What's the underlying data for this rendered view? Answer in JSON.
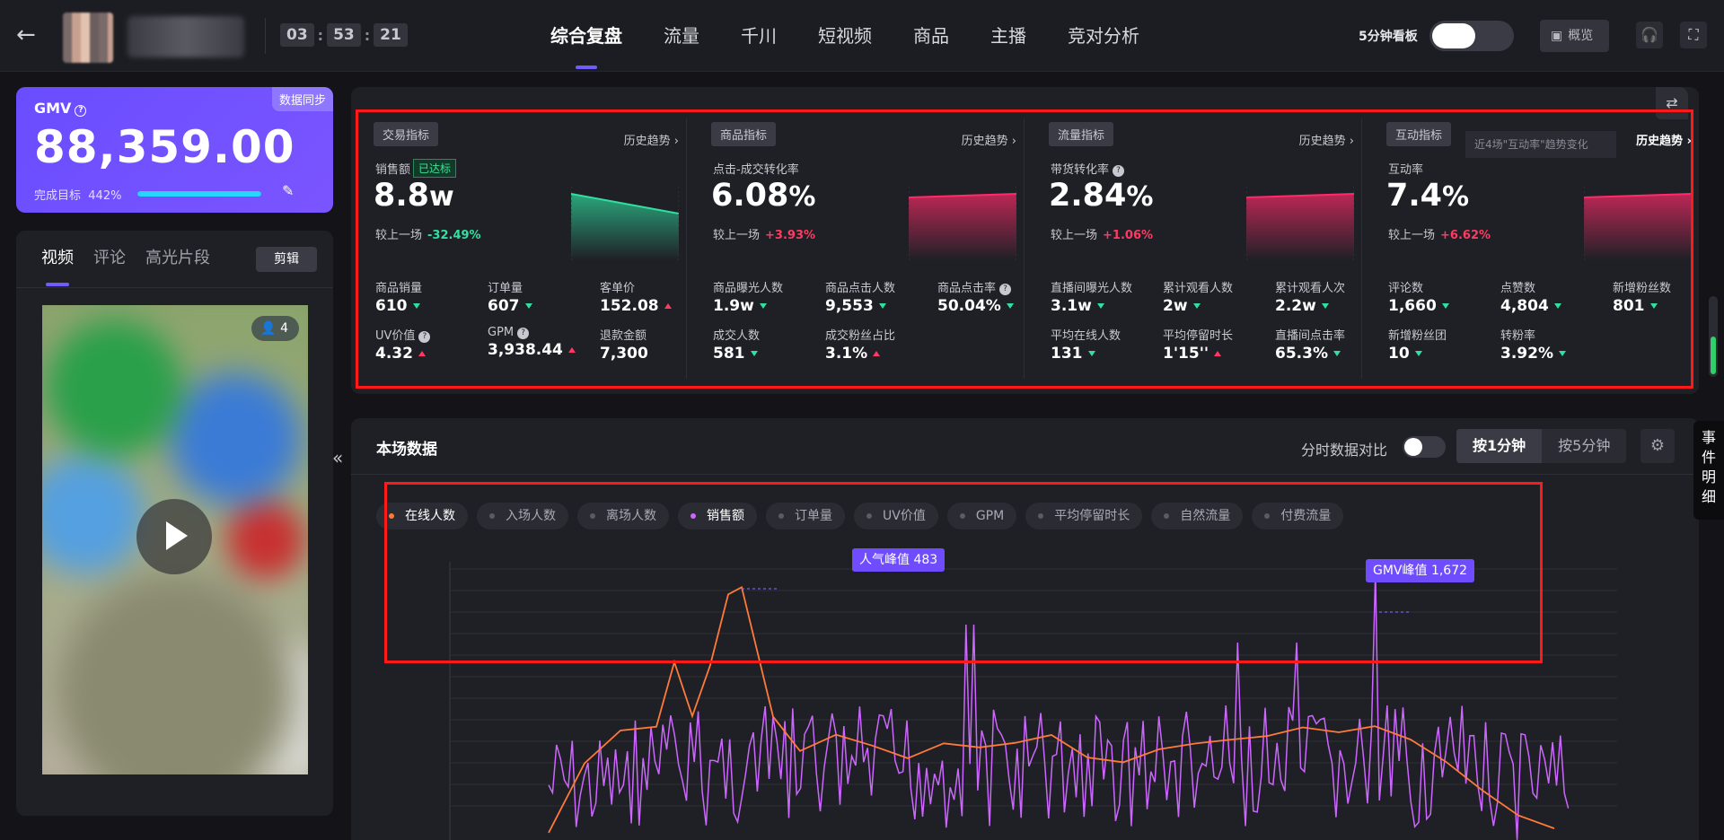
{
  "header": {
    "timer": [
      "03",
      "53",
      "21"
    ],
    "tabs": [
      "综合复盘",
      "流量",
      "千川",
      "短视频",
      "商品",
      "主播",
      "竞对分析"
    ],
    "active_tab": 0,
    "five_min_label": "5分钟看板",
    "overview_label": "概览"
  },
  "gmv": {
    "label": "GMV",
    "sync_label": "数据同步",
    "value": "88,359.00",
    "goal_label": "完成目标",
    "goal_pct": "442%",
    "progress_fraction": 1.0
  },
  "video_panel": {
    "tabs": [
      "视频",
      "评论",
      "高光片段"
    ],
    "cut_label": "剪辑",
    "viewers": "4"
  },
  "metrics": [
    {
      "tag": "交易指标",
      "history": "历史趋势",
      "name": "销售额",
      "badge": "已达标",
      "value": "8.8",
      "unit": "w",
      "compare_label": "较上一场",
      "compare": "-32.49%",
      "direction": "down",
      "spark_trend": "down",
      "items": [
        {
          "name": "商品销量",
          "value": "610",
          "dir": "down"
        },
        {
          "name": "订单量",
          "value": "607",
          "dir": "down"
        },
        {
          "name": "客单价",
          "value": "152.08",
          "dir": "up"
        },
        {
          "name": "UV价值",
          "value": "4.32",
          "dir": "up",
          "help": true
        },
        {
          "name": "GPM",
          "value": "3,938.44",
          "dir": "up",
          "help": true
        },
        {
          "name": "退款金额",
          "value": "7,300",
          "dir": ""
        }
      ]
    },
    {
      "tag": "商品指标",
      "history": "历史趋势",
      "name": "点击-成交转化率",
      "value": "6.08",
      "unit": "%",
      "compare_label": "较上一场",
      "compare": "+3.93%",
      "direction": "up",
      "spark_trend": "up",
      "items": [
        {
          "name": "商品曝光人数",
          "value": "1.9w",
          "dir": "down"
        },
        {
          "name": "商品点击人数",
          "value": "9,553",
          "dir": "down"
        },
        {
          "name": "商品点击率",
          "value": "50.04%",
          "dir": "down",
          "help": true
        },
        {
          "name": "成交人数",
          "value": "581",
          "dir": "down"
        },
        {
          "name": "成交粉丝占比",
          "value": "3.1%",
          "dir": "up"
        }
      ]
    },
    {
      "tag": "流量指标",
      "history": "历史趋势",
      "name": "带货转化率",
      "value": "2.84",
      "unit": "%",
      "compare_label": "较上一场",
      "compare": "+1.06%",
      "direction": "up",
      "spark_trend": "up",
      "name_help": true,
      "items": [
        {
          "name": "直播间曝光人数",
          "value": "3.1w",
          "dir": "down"
        },
        {
          "name": "累计观看人数",
          "value": "2w",
          "dir": "down"
        },
        {
          "name": "累计观看人次",
          "value": "2.2w",
          "dir": "down"
        },
        {
          "name": "平均在线人数",
          "value": "131",
          "dir": "down"
        },
        {
          "name": "平均停留时长",
          "value": "1'15''",
          "dir": "up"
        },
        {
          "name": "直播间点击率",
          "value": "65.3%",
          "dir": "down"
        }
      ]
    },
    {
      "tag": "互动指标",
      "history": "历史趋势",
      "tooltip": "近4场\"互动率\"趋势变化",
      "name": "互动率",
      "value": "7.4",
      "unit": "%",
      "compare_label": "较上一场",
      "compare": "+6.62%",
      "direction": "up",
      "spark_trend": "up",
      "items": [
        {
          "name": "评论数",
          "value": "1,660",
          "dir": "down"
        },
        {
          "name": "点赞数",
          "value": "4,804",
          "dir": "down"
        },
        {
          "name": "新增粉丝数",
          "value": "801",
          "dir": "down"
        },
        {
          "name": "新增粉丝团",
          "value": "10",
          "dir": "down"
        },
        {
          "name": "转粉率",
          "value": "3.92%",
          "dir": "down"
        }
      ]
    }
  ],
  "chart": {
    "title": "本场数据",
    "compare_label": "分时数据对比",
    "seg": [
      "按1分钟",
      "按5分钟"
    ],
    "legend": [
      {
        "label": "在线人数",
        "active": true,
        "color": "#ff7a3a"
      },
      {
        "label": "入场人数",
        "active": false,
        "color": ""
      },
      {
        "label": "离场人数",
        "active": false,
        "color": ""
      },
      {
        "label": "销售额",
        "active": true,
        "color": "#cc66ff"
      },
      {
        "label": "订单量",
        "active": false,
        "color": ""
      },
      {
        "label": "UV价值",
        "active": false,
        "color": ""
      },
      {
        "label": "GPM",
        "active": false,
        "color": ""
      },
      {
        "label": "平均停留时长",
        "active": false,
        "color": ""
      },
      {
        "label": "自然流量",
        "active": false,
        "color": ""
      },
      {
        "label": "付费流量",
        "active": false,
        "color": ""
      }
    ],
    "peak_online": "人气峰值 483",
    "peak_gmv": "GMV峰值 1,672"
  },
  "side_tab": "事件明细"
}
